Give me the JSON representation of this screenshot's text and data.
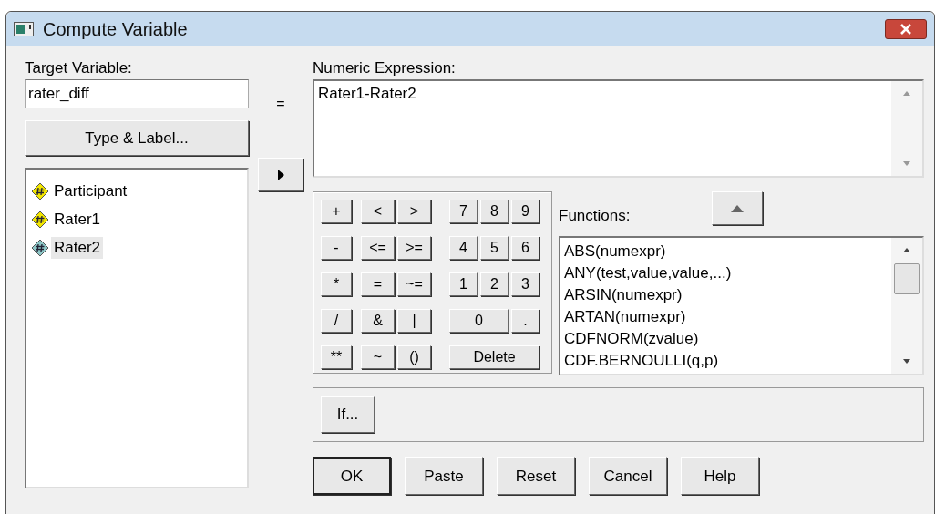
{
  "window": {
    "title": "Compute Variable"
  },
  "target": {
    "label": "Target Variable:",
    "value": "rater_diff"
  },
  "equals": "=",
  "type_label_button": "Type & Label...",
  "variables": [
    {
      "name": "Participant",
      "color": "#f2e600",
      "selected": false
    },
    {
      "name": "Rater1",
      "color": "#f2e600",
      "selected": false
    },
    {
      "name": "Rater2",
      "color": "#8ec8c8",
      "selected": true
    }
  ],
  "expression": {
    "label": "Numeric Expression:",
    "value": "Rater1-Rater2"
  },
  "keypad": [
    {
      "op": [
        "+"
      ],
      "rel": [
        "<",
        ">"
      ],
      "num": [
        "7",
        "8",
        "9"
      ]
    },
    {
      "op": [
        "-"
      ],
      "rel": [
        "<=",
        ">="
      ],
      "num": [
        "4",
        "5",
        "6"
      ]
    },
    {
      "op": [
        "*"
      ],
      "rel": [
        "=",
        "~="
      ],
      "num": [
        "1",
        "2",
        "3"
      ]
    },
    {
      "op": [
        "/"
      ],
      "rel": [
        "&",
        "|"
      ],
      "num": [
        "0",
        "."
      ]
    },
    {
      "op": [
        "**"
      ],
      "rel": [
        "~",
        "()"
      ],
      "num": [
        "Delete"
      ]
    }
  ],
  "functions": {
    "label": "Functions:",
    "items": [
      "ABS(numexpr)",
      "ANY(test,value,value,...)",
      "ARSIN(numexpr)",
      "ARTAN(numexpr)",
      "CDFNORM(zvalue)",
      "CDF.BERNOULLI(q,p)"
    ]
  },
  "if_button": "If...",
  "buttons": [
    "OK",
    "Paste",
    "Reset",
    "Cancel",
    "Help"
  ]
}
